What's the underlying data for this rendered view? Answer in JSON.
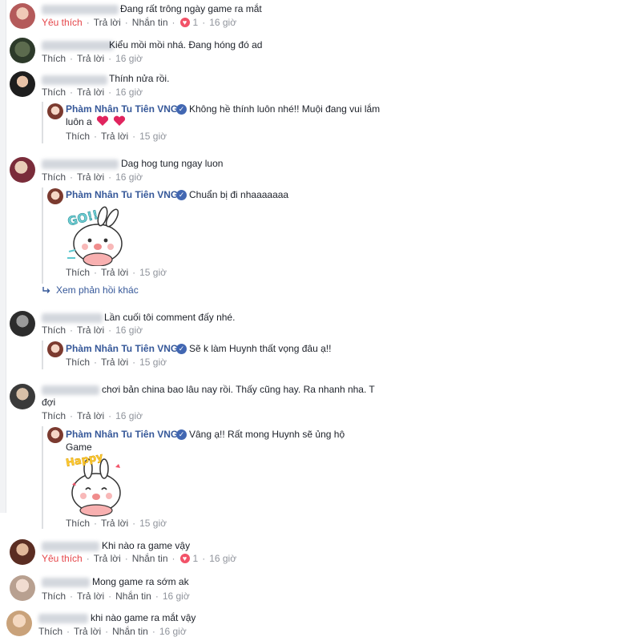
{
  "comments": [
    {
      "id": "c1",
      "text": "Đang rất trông ngày game ra mắt",
      "like": "Yêu thích",
      "reply": "Trả lời",
      "message": "Nhắn tin",
      "reaction_count": "1",
      "time": "16 giờ"
    },
    {
      "id": "c2",
      "text": "Kiểu mồi mồi nhá. Đang hóng đó ad",
      "like": "Thích",
      "reply": "Trả lời",
      "time": "16 giờ"
    },
    {
      "id": "c3",
      "text": "Thính nửa rồi.",
      "like": "Thích",
      "reply": "Trả lời",
      "time": "16 giờ"
    },
    {
      "id": "c4",
      "text": "Dag hog tung ngay luon",
      "like": "Thích",
      "reply": "Trả lời",
      "time": "16 giờ"
    },
    {
      "id": "c5",
      "text": "Lần cuối tôi comment đấy nhé.",
      "like": "Thích",
      "reply": "Trả lời",
      "time": "16 giờ"
    },
    {
      "id": "c6",
      "text": "chơi bản china bao lâu nay rồi. Thấy cũng hay. Ra nhanh nha. T đợi",
      "like": "Thích",
      "reply": "Trả lời",
      "time": "16 giờ"
    },
    {
      "id": "c7",
      "text": "Khi nào ra game vậy",
      "like": "Yêu thích",
      "reply": "Trả lời",
      "message": "Nhắn tin",
      "reaction_count": "1",
      "time": "16 giờ"
    },
    {
      "id": "c8",
      "text": "Mong game ra sớm ak",
      "like": "Thích",
      "reply": "Trả lời",
      "message": "Nhắn tin",
      "time": "16 giờ"
    },
    {
      "id": "c9",
      "text": "khi nào game ra mắt vậy",
      "like": "Thích",
      "reply": "Trả lời",
      "message": "Nhắn tin",
      "time": "16 giờ"
    }
  ],
  "replies": [
    {
      "id": "r1",
      "author": "Phàm Nhân Tu Tiên VNG",
      "text": "Không hề thính luôn nhé!! Muội đang vui lắm luôn a",
      "like": "Thích",
      "reply": "Trả lời",
      "time": "15 giờ"
    },
    {
      "id": "r2",
      "author": "Phàm Nhân Tu Tiên VNG",
      "text": "Chuẩn bị đi nhaaaaaaa",
      "sticker_text": "GO!!",
      "like": "Thích",
      "reply": "Trả lời",
      "time": "15 giờ"
    },
    {
      "id": "r3",
      "author": "Phàm Nhân Tu Tiên VNG",
      "text": "Sẽ k làm Huynh thất vọng đâu ạ!!",
      "like": "Thích",
      "reply": "Trả lời",
      "time": "15 giờ"
    },
    {
      "id": "r4",
      "author": "Phàm Nhân Tu Tiên VNG",
      "text": "Vâng ạ!! Rất mong Huynh sẽ ủng hộ Game",
      "sticker_text": "Happy",
      "like": "Thích",
      "reply": "Trả lời",
      "time": "15 giờ"
    }
  ],
  "more_replies": "Xem phản hồi khác",
  "colors": {
    "link": "#365899",
    "muted": "#90949c",
    "love": "#e5474b",
    "verified": "#4267b2"
  },
  "icons": {
    "verified": "verified-badge-icon",
    "heart": "heart-icon",
    "reply_arrow": "reply-arrow-icon"
  }
}
